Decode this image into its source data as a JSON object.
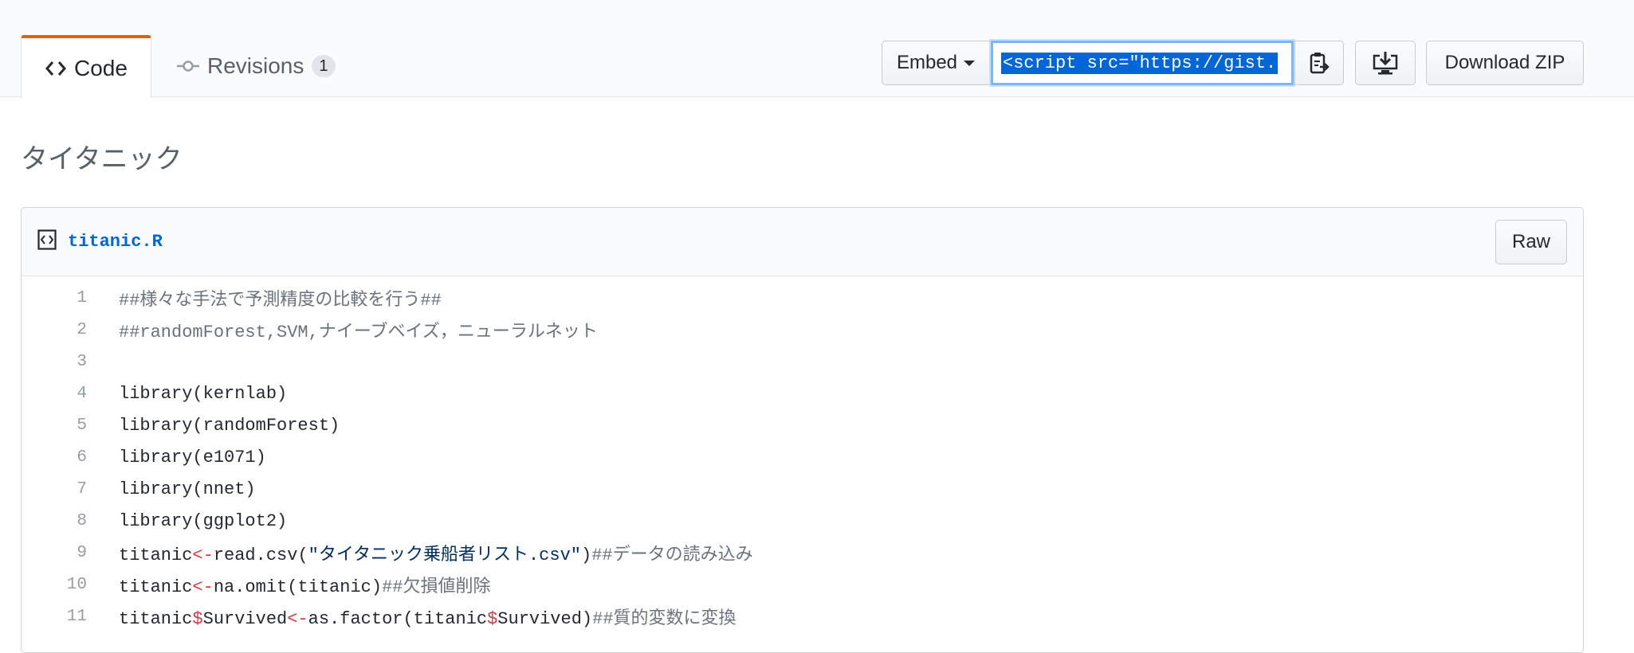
{
  "tabs": {
    "code_label": "Code",
    "revisions_label": "Revisions",
    "revisions_count": "1"
  },
  "toolbar": {
    "embed_label": "Embed",
    "embed_value": "<script src=\"https://gist.",
    "download_zip_label": "Download ZIP"
  },
  "gist": {
    "title": "タイタニック"
  },
  "file": {
    "name": "titanic.R",
    "raw_label": "Raw",
    "lines": [
      {
        "n": "1",
        "parts": [
          {
            "t": "##様々な手法で予測精度の比較を行う##",
            "c": "cmt"
          }
        ]
      },
      {
        "n": "2",
        "parts": [
          {
            "t": "##randomForest,SVM,ナイーブベイズ，ニューラルネット",
            "c": "cmt"
          }
        ]
      },
      {
        "n": "3",
        "parts": []
      },
      {
        "n": "4",
        "parts": [
          {
            "t": "library(kernlab)",
            "c": ""
          }
        ]
      },
      {
        "n": "5",
        "parts": [
          {
            "t": "library(randomForest)",
            "c": ""
          }
        ]
      },
      {
        "n": "6",
        "parts": [
          {
            "t": "library(e1071)",
            "c": ""
          }
        ]
      },
      {
        "n": "7",
        "parts": [
          {
            "t": "library(nnet)",
            "c": ""
          }
        ]
      },
      {
        "n": "8",
        "parts": [
          {
            "t": "library(ggplot2)",
            "c": ""
          }
        ]
      },
      {
        "n": "9",
        "parts": [
          {
            "t": "titanic",
            "c": ""
          },
          {
            "t": "<-",
            "c": "kw"
          },
          {
            "t": "read.csv(",
            "c": ""
          },
          {
            "t": "\"タイタニック乗船者リスト.csv\"",
            "c": "str"
          },
          {
            "t": ")",
            "c": ""
          },
          {
            "t": "##データの読み込み",
            "c": "cmt"
          }
        ]
      },
      {
        "n": "10",
        "parts": [
          {
            "t": "titanic",
            "c": ""
          },
          {
            "t": "<-",
            "c": "kw"
          },
          {
            "t": "na.omit(titanic)",
            "c": ""
          },
          {
            "t": "##欠損値削除",
            "c": "cmt"
          }
        ]
      },
      {
        "n": "11",
        "parts": [
          {
            "t": "titanic",
            "c": ""
          },
          {
            "t": "$",
            "c": "kw"
          },
          {
            "t": "Survived",
            "c": ""
          },
          {
            "t": "<-",
            "c": "kw"
          },
          {
            "t": "as.factor(titanic",
            "c": ""
          },
          {
            "t": "$",
            "c": "kw"
          },
          {
            "t": "Survived)",
            "c": ""
          },
          {
            "t": "##質的変数に変換",
            "c": "cmt"
          }
        ]
      }
    ]
  }
}
